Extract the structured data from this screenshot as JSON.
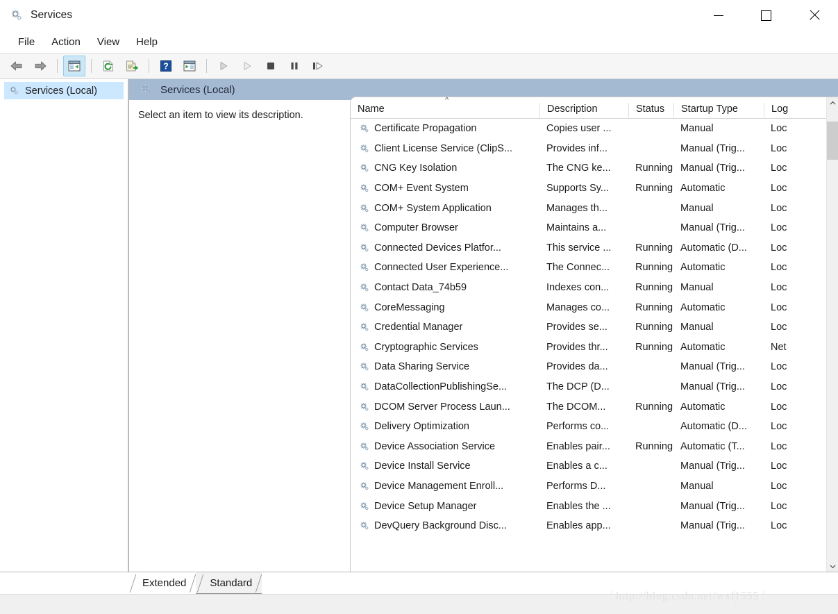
{
  "window": {
    "title": "Services",
    "icon": "services-gear-icon",
    "controls": {
      "minimize": "minimize-icon",
      "maximize": "maximize-icon",
      "close": "close-icon"
    }
  },
  "menubar": {
    "items": [
      "File",
      "Action",
      "View",
      "Help"
    ]
  },
  "toolbar": {
    "buttons": [
      {
        "name": "back-button",
        "icon": "arrow-left-icon",
        "active": false
      },
      {
        "name": "forward-button",
        "icon": "arrow-right-icon",
        "active": false
      },
      {
        "name": "show-hide-tree-button",
        "icon": "console-tree-icon",
        "active": true
      },
      {
        "name": "refresh-button",
        "icon": "refresh-icon",
        "active": false
      },
      {
        "name": "export-list-button",
        "icon": "export-list-icon",
        "active": false
      },
      {
        "name": "help-button",
        "icon": "help-question-icon",
        "active": false
      },
      {
        "name": "properties-button",
        "icon": "properties-icon",
        "active": false
      },
      {
        "name": "start-service-button",
        "icon": "play-icon",
        "active": false
      },
      {
        "name": "resume-service-button",
        "icon": "play-outline-icon",
        "active": false
      },
      {
        "name": "stop-service-button",
        "icon": "stop-icon",
        "active": false
      },
      {
        "name": "pause-service-button",
        "icon": "pause-icon",
        "active": false
      },
      {
        "name": "restart-service-button",
        "icon": "restart-icon",
        "active": false
      }
    ]
  },
  "sidebar": {
    "items": [
      {
        "label": "Services (Local)",
        "icon": "services-gear-icon",
        "selected": true
      }
    ]
  },
  "description_panel": {
    "header_title": "Services (Local)",
    "header_icon": "services-gear-icon",
    "body_text": "Select an item to view its description."
  },
  "list": {
    "columns": [
      {
        "key": "name",
        "label": "Name",
        "sorted": true,
        "sort_direction": "ascending"
      },
      {
        "key": "desc",
        "label": "Description",
        "sorted": false
      },
      {
        "key": "status",
        "label": "Status",
        "sorted": false
      },
      {
        "key": "startup",
        "label": "Startup Type",
        "sorted": false
      },
      {
        "key": "logon",
        "label": "Log",
        "sorted": false
      }
    ],
    "rows": [
      {
        "name": "Certificate Propagation",
        "desc": "Copies user ...",
        "status": "",
        "startup": "Manual",
        "logon": "Loc"
      },
      {
        "name": "Client License Service (ClipS...",
        "desc": "Provides inf...",
        "status": "",
        "startup": "Manual (Trig...",
        "logon": "Loc"
      },
      {
        "name": "CNG Key Isolation",
        "desc": "The CNG ke...",
        "status": "Running",
        "startup": "Manual (Trig...",
        "logon": "Loc"
      },
      {
        "name": "COM+ Event System",
        "desc": "Supports Sy...",
        "status": "Running",
        "startup": "Automatic",
        "logon": "Loc"
      },
      {
        "name": "COM+ System Application",
        "desc": "Manages th...",
        "status": "",
        "startup": "Manual",
        "logon": "Loc"
      },
      {
        "name": "Computer Browser",
        "desc": "Maintains a...",
        "status": "",
        "startup": "Manual (Trig...",
        "logon": "Loc"
      },
      {
        "name": "Connected Devices Platfor...",
        "desc": "This service ...",
        "status": "Running",
        "startup": "Automatic (D...",
        "logon": "Loc"
      },
      {
        "name": "Connected User Experience...",
        "desc": "The Connec...",
        "status": "Running",
        "startup": "Automatic",
        "logon": "Loc"
      },
      {
        "name": "Contact Data_74b59",
        "desc": "Indexes con...",
        "status": "Running",
        "startup": "Manual",
        "logon": "Loc"
      },
      {
        "name": "CoreMessaging",
        "desc": "Manages co...",
        "status": "Running",
        "startup": "Automatic",
        "logon": "Loc"
      },
      {
        "name": "Credential Manager",
        "desc": "Provides se...",
        "status": "Running",
        "startup": "Manual",
        "logon": "Loc"
      },
      {
        "name": "Cryptographic Services",
        "desc": "Provides thr...",
        "status": "Running",
        "startup": "Automatic",
        "logon": "Net"
      },
      {
        "name": "Data Sharing Service",
        "desc": "Provides da...",
        "status": "",
        "startup": "Manual (Trig...",
        "logon": "Loc"
      },
      {
        "name": "DataCollectionPublishingSe...",
        "desc": "The DCP (D...",
        "status": "",
        "startup": "Manual (Trig...",
        "logon": "Loc"
      },
      {
        "name": "DCOM Server Process Laun...",
        "desc": "The DCOM...",
        "status": "Running",
        "startup": "Automatic",
        "logon": "Loc"
      },
      {
        "name": "Delivery Optimization",
        "desc": "Performs co...",
        "status": "",
        "startup": "Automatic (D...",
        "logon": "Loc"
      },
      {
        "name": "Device Association Service",
        "desc": "Enables pair...",
        "status": "Running",
        "startup": "Automatic (T...",
        "logon": "Loc"
      },
      {
        "name": "Device Install Service",
        "desc": "Enables a c...",
        "status": "",
        "startup": "Manual (Trig...",
        "logon": "Loc"
      },
      {
        "name": "Device Management Enroll...",
        "desc": "Performs D...",
        "status": "",
        "startup": "Manual",
        "logon": "Loc"
      },
      {
        "name": "Device Setup Manager",
        "desc": "Enables the ...",
        "status": "",
        "startup": "Manual (Trig...",
        "logon": "Loc"
      },
      {
        "name": "DevQuery Background Disc...",
        "desc": "Enables app...",
        "status": "",
        "startup": "Manual (Trig...",
        "logon": "Loc"
      }
    ]
  },
  "scrollbars": {
    "vertical": {
      "up_arrow": "chevron-up-icon",
      "down_arrow": "chevron-down-icon"
    },
    "horizontal": {
      "left_arrow": "chevron-left-icon",
      "right_arrow": "chevron-right-icon"
    }
  },
  "tabs": [
    {
      "label": "Extended",
      "active": true
    },
    {
      "label": "Standard",
      "active": false
    }
  ],
  "watermark": {
    "text": "http://blog.csdn.net/wxl1555"
  },
  "colors": {
    "desc_header_bg": "#a4b9d2",
    "selection_blue": "#cce8ff",
    "toolbar_active": "#cce8f7",
    "window_bg": "#ffffff"
  }
}
